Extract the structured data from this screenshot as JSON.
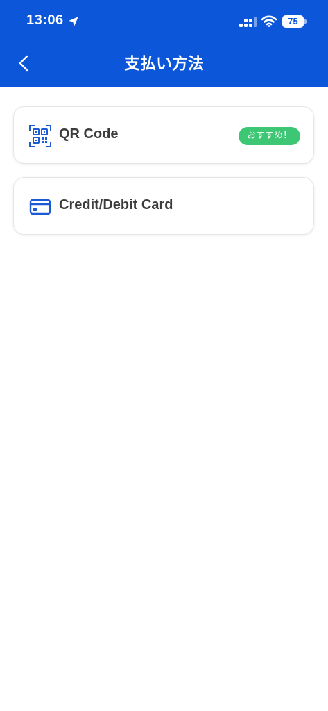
{
  "status_bar": {
    "time": "13:06",
    "battery": "75"
  },
  "nav": {
    "title": "支払い方法"
  },
  "payment_methods": [
    {
      "label": "QR Code",
      "badge": "おすすめ！"
    },
    {
      "label": "Credit/Debit Card"
    }
  ],
  "colors": {
    "header": "#0B56D9",
    "badge": "#3DC673",
    "icon": "#1D5BD4"
  },
  "icons": {
    "back": "chevron-left-icon",
    "qr": "qr-code-icon",
    "card": "credit-card-icon"
  }
}
